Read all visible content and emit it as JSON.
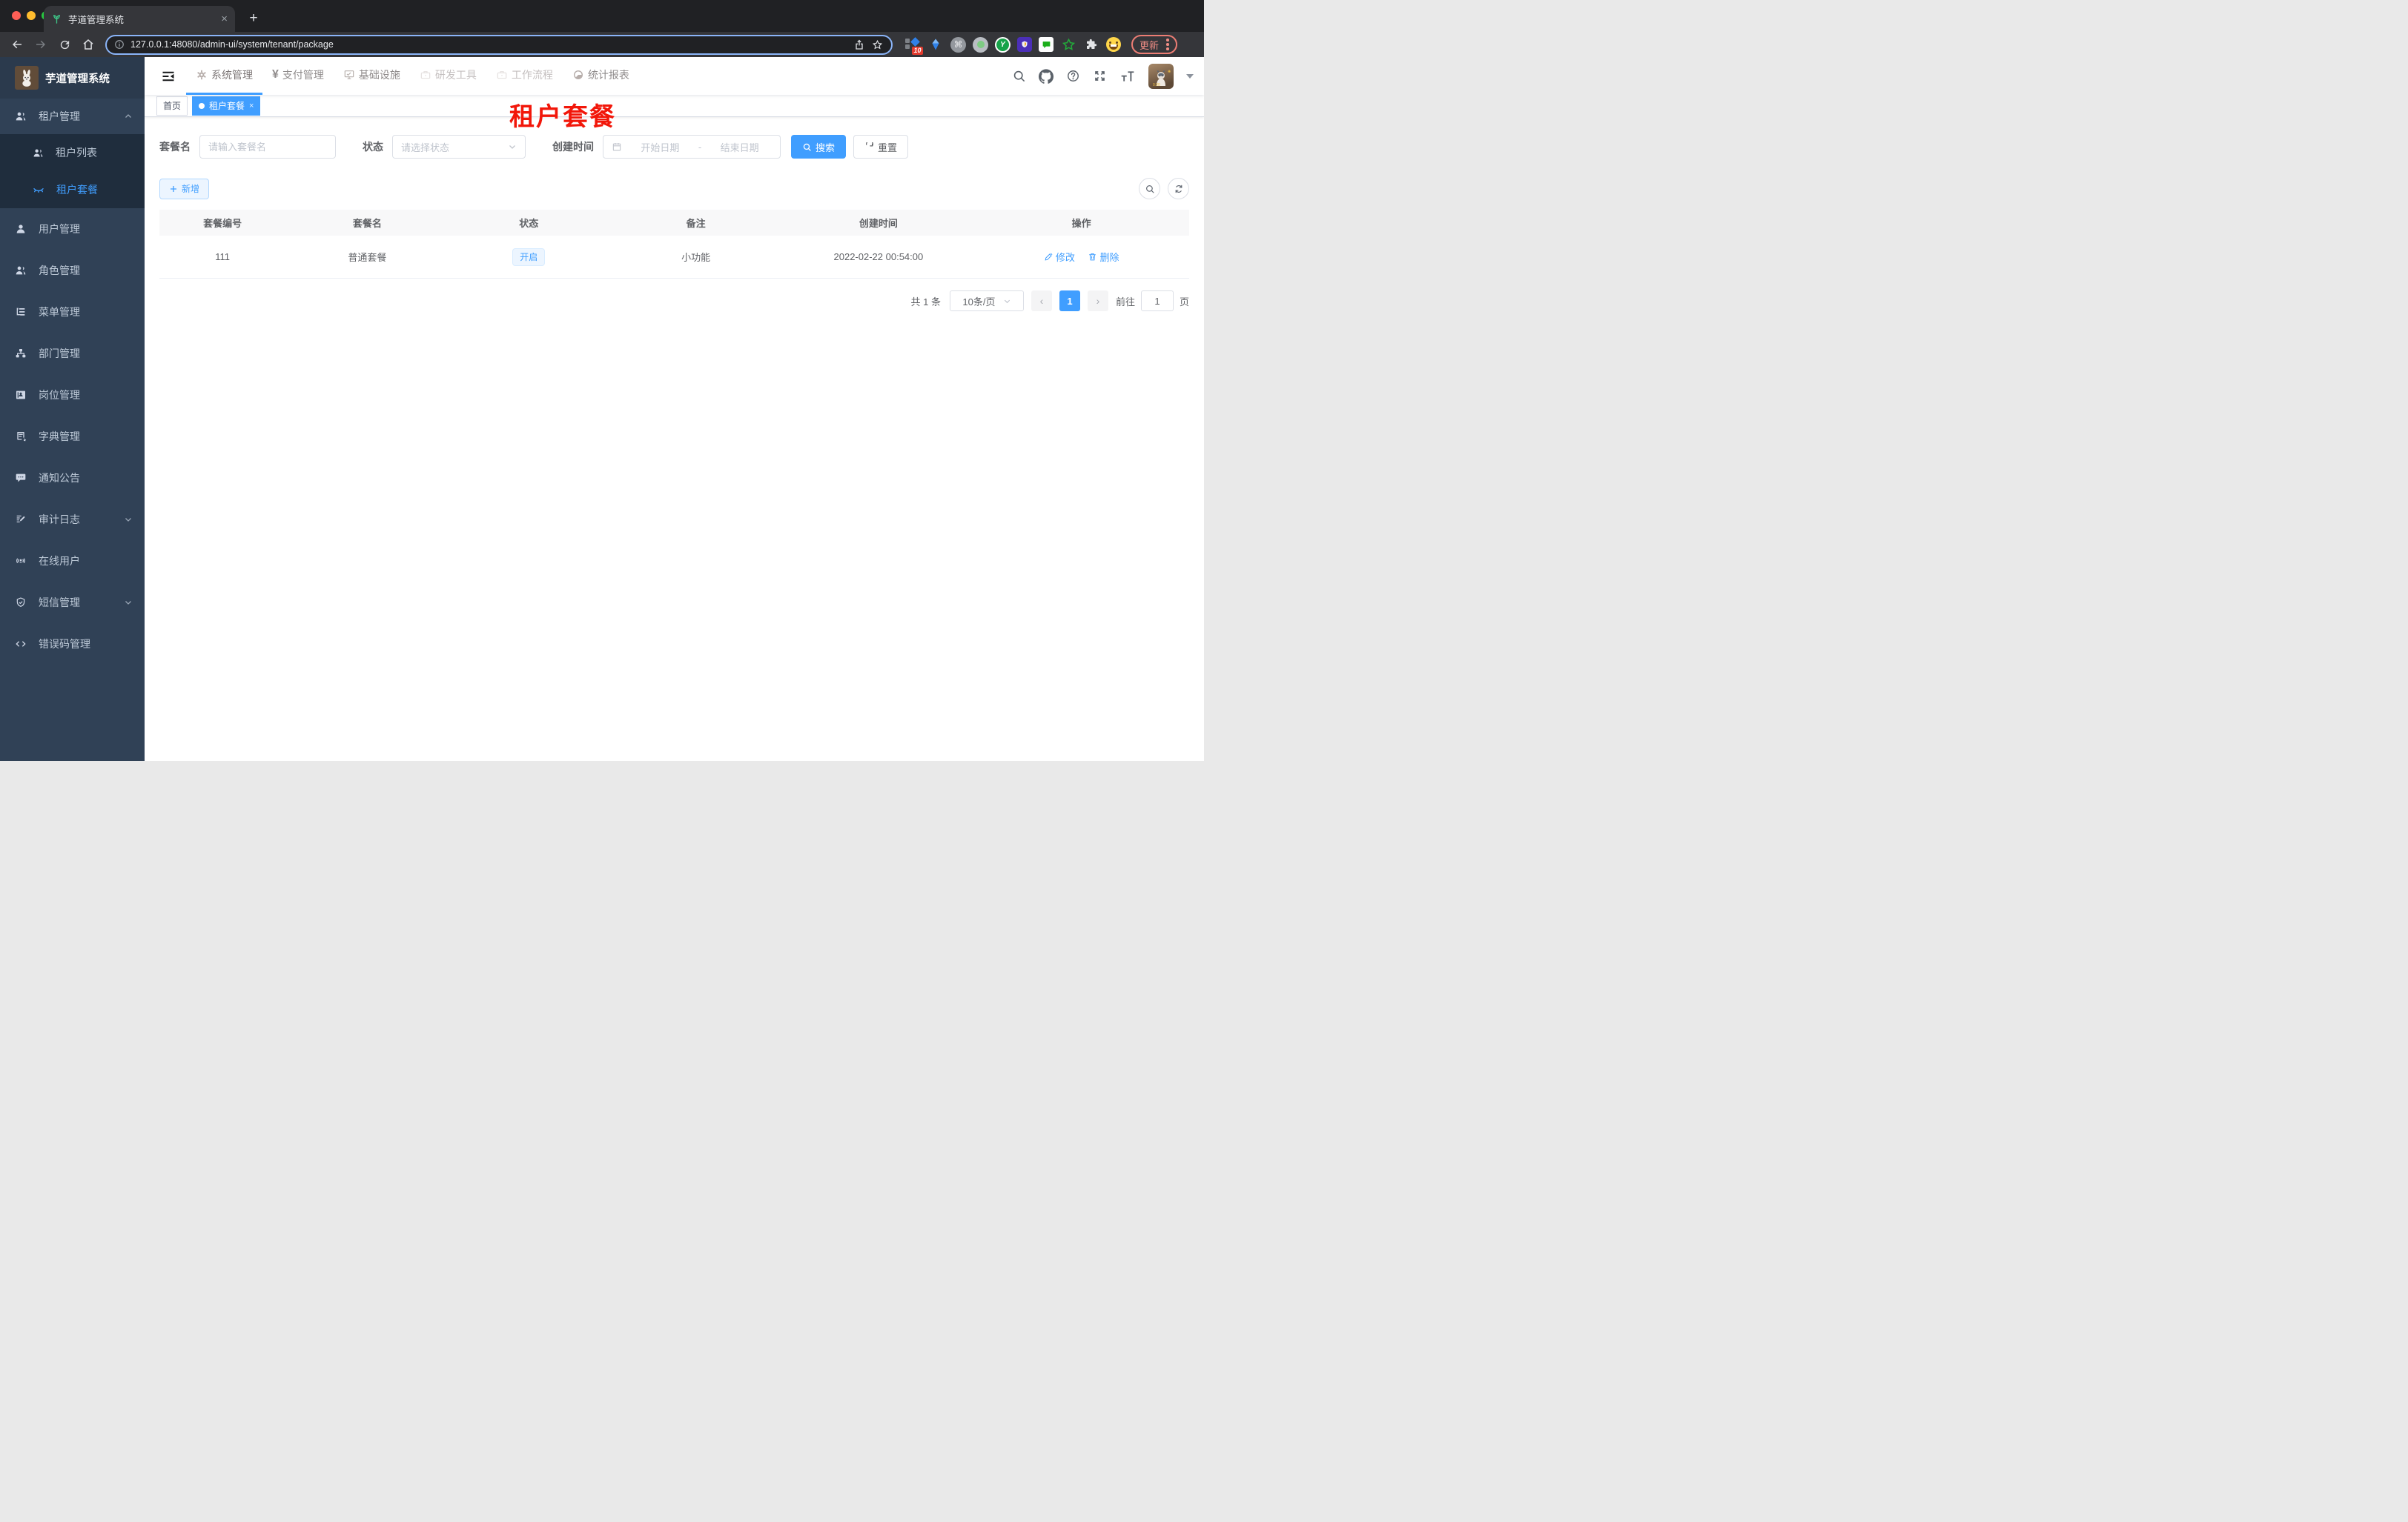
{
  "browser": {
    "tab_title": "芋道管理系统",
    "tab_close": "×",
    "new_tab": "+",
    "url": "127.0.0.1:48080/admin-ui/system/tenant/package",
    "update_label": "更新",
    "extensions": {
      "badge": "10",
      "cmd_glyph": "⌘",
      "y_glyph": "Y"
    }
  },
  "app": {
    "logo_title": "芋道管理系统",
    "sidebar": {
      "group_tenant": "租户管理",
      "tenant_children": [
        {
          "label": "租户列表"
        },
        {
          "label": "租户套餐"
        }
      ],
      "items": [
        {
          "label": "用户管理"
        },
        {
          "label": "角色管理"
        },
        {
          "label": "菜单管理"
        },
        {
          "label": "部门管理"
        },
        {
          "label": "岗位管理"
        },
        {
          "label": "字典管理"
        },
        {
          "label": "通知公告"
        },
        {
          "label": "审计日志"
        },
        {
          "label": "在线用户"
        },
        {
          "label": "短信管理"
        },
        {
          "label": "错误码管理"
        }
      ]
    },
    "topnav": {
      "yen_glyph": "¥",
      "items": [
        {
          "label": "系统管理"
        },
        {
          "label": "支付管理"
        },
        {
          "label": "基础设施"
        },
        {
          "label": "研发工具"
        },
        {
          "label": "工作流程"
        },
        {
          "label": "统计报表"
        }
      ]
    },
    "tags": {
      "home": "首页",
      "active": "租户套餐",
      "close": "×"
    },
    "annotation": "租户套餐"
  },
  "filters": {
    "name_label": "套餐名",
    "name_placeholder": "请输入套餐名",
    "status_label": "状态",
    "status_placeholder": "请选择状态",
    "date_label": "创建时间",
    "date_start_placeholder": "开始日期",
    "date_separator": "-",
    "date_end_placeholder": "结束日期",
    "search_label": "搜索",
    "reset_label": "重置"
  },
  "toolbar": {
    "add_label": "新增"
  },
  "table": {
    "headers": [
      "套餐编号",
      "套餐名",
      "状态",
      "备注",
      "创建时间",
      "操作"
    ],
    "rows": [
      {
        "id": "111",
        "name": "普通套餐",
        "status": "开启",
        "remark": "小功能",
        "created_at": "2022-02-22 00:54:00",
        "edit_label": "修改",
        "delete_label": "删除"
      }
    ]
  },
  "pagination": {
    "total": "共 1 条",
    "page_size": "10条/页",
    "prev": "‹",
    "current_page": "1",
    "next": "›",
    "goto_label": "前往",
    "goto_value": "1",
    "page_unit": "页"
  }
}
